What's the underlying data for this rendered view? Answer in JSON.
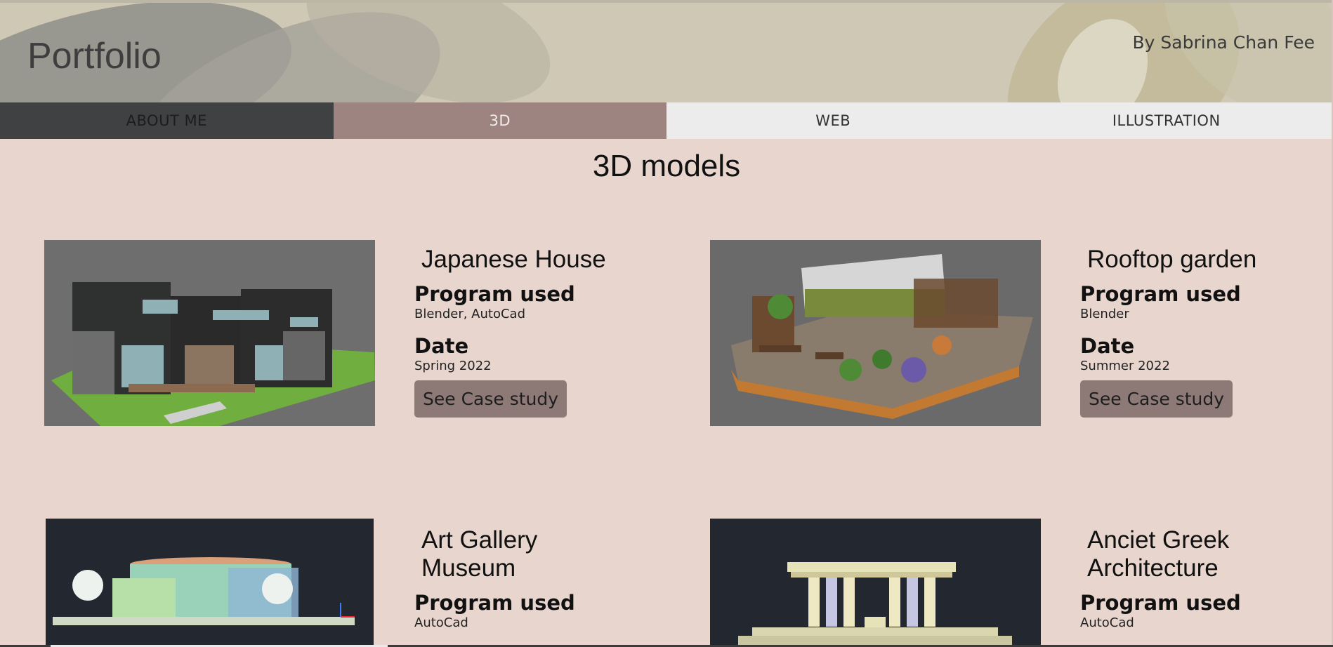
{
  "header": {
    "brand": "Portfolio",
    "author": "By Sabrina Chan Fee"
  },
  "nav": {
    "tabs": [
      {
        "label": "ABOUT ME"
      },
      {
        "label": "3D",
        "active": true
      },
      {
        "label": "WEB"
      },
      {
        "label": "ILLUSTRATION"
      }
    ]
  },
  "main": {
    "title": "3D models",
    "projects": [
      {
        "title": "Japanese House",
        "program_label": "Program used",
        "program": "Blender, AutoCad",
        "date_label": "Date",
        "date": "Spring 2022",
        "button": "See Case study"
      },
      {
        "title": "Rooftop garden",
        "program_label": "Program used",
        "program": "Blender",
        "date_label": "Date",
        "date": "Summer 2022",
        "button": "See Case study"
      },
      {
        "title": "Art Gallery Museum",
        "program_label": "Program used",
        "program": "AutoCad"
      },
      {
        "title": "Anciet Greek Architecture",
        "program_label": "Program used",
        "program": "AutoCad"
      }
    ]
  },
  "colors": {
    "page_bg": "#e8d6ce",
    "active_tab": "#9d8480",
    "dark_tab": "#3f4142",
    "button": "#8d7a77"
  }
}
